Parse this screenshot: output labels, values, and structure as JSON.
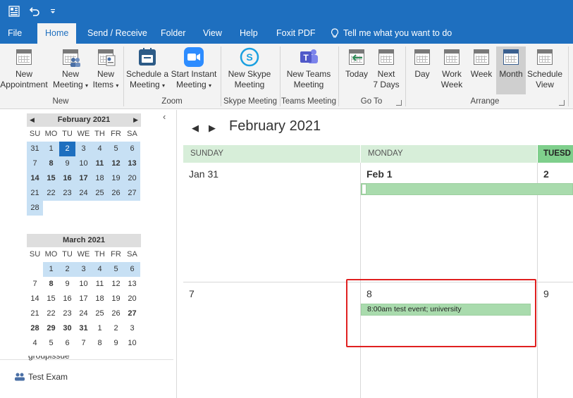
{
  "ribbon_tabs": [
    {
      "label": "File"
    },
    {
      "label": "Home",
      "active": true
    },
    {
      "label": "Send / Receive"
    },
    {
      "label": "Folder"
    },
    {
      "label": "View"
    },
    {
      "label": "Help"
    },
    {
      "label": "Foxit PDF"
    },
    {
      "label": "Tell me what you want to do",
      "icon": "lightbulb-icon"
    }
  ],
  "ribbon": {
    "new_appointment": [
      "New",
      "Appointment"
    ],
    "new_meeting": [
      "New",
      "Meeting"
    ],
    "new_items": [
      "New",
      "Items"
    ],
    "schedule_meeting": [
      "Schedule a",
      "Meeting"
    ],
    "start_instant_meeting": [
      "Start Instant",
      "Meeting"
    ],
    "new_skype_meeting": [
      "New Skype",
      "Meeting"
    ],
    "new_teams_meeting": [
      "New Teams",
      "Meeting"
    ],
    "today": [
      "Today"
    ],
    "next_7_days": [
      "Next",
      "7 Days"
    ],
    "day": [
      "Day"
    ],
    "work_week": [
      "Work",
      "Week"
    ],
    "week": [
      "Week"
    ],
    "month": [
      "Month"
    ],
    "schedule_view": [
      "Schedule",
      "View"
    ],
    "groups": {
      "new": "New",
      "zoom": "Zoom",
      "skype_meeting": "Skype Meeting",
      "teams_meeting": "Teams Meeting",
      "goto": "Go To",
      "arrange": "Arrange"
    }
  },
  "minicals": [
    {
      "title": "February 2021",
      "dow": [
        "SU",
        "MO",
        "TU",
        "WE",
        "TH",
        "FR",
        "SA"
      ],
      "rows": [
        [
          "31",
          "1",
          "2",
          "3",
          "4",
          "5",
          "6"
        ],
        [
          "7",
          "8",
          "9",
          "10",
          "11",
          "12",
          "13"
        ],
        [
          "14",
          "15",
          "16",
          "17",
          "18",
          "19",
          "20"
        ],
        [
          "21",
          "22",
          "23",
          "24",
          "25",
          "26",
          "27"
        ],
        [
          "28"
        ]
      ],
      "today": "2",
      "bold": [
        "8",
        "11",
        "12",
        "13",
        "14",
        "15",
        "16",
        "17"
      ]
    },
    {
      "title": "March 2021",
      "dow": [
        "SU",
        "MO",
        "TU",
        "WE",
        "TH",
        "FR",
        "SA"
      ],
      "rows": [
        [
          "",
          "1",
          "2",
          "3",
          "4",
          "5",
          "6"
        ],
        [
          "7",
          "8",
          "9",
          "10",
          "11",
          "12",
          "13"
        ],
        [
          "14",
          "15",
          "16",
          "17",
          "18",
          "19",
          "20"
        ],
        [
          "21",
          "22",
          "23",
          "24",
          "25",
          "26",
          "27"
        ],
        [
          "28",
          "29",
          "30",
          "31",
          "1",
          "2",
          "3"
        ],
        [
          "4",
          "5",
          "6",
          "7",
          "8",
          "9",
          "10"
        ]
      ],
      "bold": [
        "8",
        "27",
        "28",
        "29",
        "30",
        "31"
      ]
    }
  ],
  "nav_items": [
    {
      "label": "groupissue"
    },
    {
      "label": "Test Exam"
    }
  ],
  "calendar": {
    "title": "February 2021",
    "day_headers": [
      "SUNDAY",
      "MONDAY",
      "TUESD"
    ],
    "week1": [
      "Jan 31",
      "Feb 1",
      "2"
    ],
    "week2": [
      "7",
      "8",
      "9"
    ],
    "event": "8:00am test event; university"
  },
  "colors": {
    "accent": "#1e6fbf",
    "event_green": "#a9dbad",
    "highlight_red": "#e02020"
  }
}
